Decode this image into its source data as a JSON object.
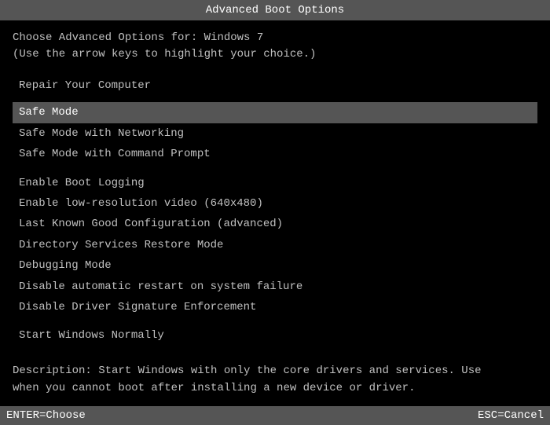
{
  "titleBar": {
    "title": "Advanced Boot Options"
  },
  "header": {
    "line1": "Choose Advanced Options for: Windows 7",
    "line2": "(Use the arrow keys to highlight your choice.)"
  },
  "menuItems": [
    {
      "id": "repair",
      "label": "Repair Your Computer",
      "selected": false,
      "topSection": true
    },
    {
      "id": "safe-mode",
      "label": "Safe Mode",
      "selected": true,
      "topSection": false
    },
    {
      "id": "safe-mode-networking",
      "label": "Safe Mode with Networking",
      "selected": false,
      "topSection": false
    },
    {
      "id": "safe-mode-cmd",
      "label": "Safe Mode with Command Prompt",
      "selected": false,
      "topSection": false
    },
    {
      "id": "enable-boot-logging",
      "label": "Enable Boot Logging",
      "selected": false,
      "topSection": false
    },
    {
      "id": "low-res-video",
      "label": "Enable low-resolution video (640x480)",
      "selected": false,
      "topSection": false
    },
    {
      "id": "last-known-good",
      "label": "Last Known Good Configuration (advanced)",
      "selected": false,
      "topSection": false
    },
    {
      "id": "directory-services",
      "label": "Directory Services Restore Mode",
      "selected": false,
      "topSection": false
    },
    {
      "id": "debugging-mode",
      "label": "Debugging Mode",
      "selected": false,
      "topSection": false
    },
    {
      "id": "disable-restart",
      "label": "Disable automatic restart on system failure",
      "selected": false,
      "topSection": false
    },
    {
      "id": "disable-driver-sig",
      "label": "Disable Driver Signature Enforcement",
      "selected": false,
      "topSection": false
    },
    {
      "id": "start-normally",
      "label": "Start Windows Normally",
      "selected": false,
      "topSection": false
    }
  ],
  "description": {
    "line1": "Description: Start Windows with only the core drivers and services. Use",
    "line2": "             when you cannot boot after installing a new device or driver."
  },
  "statusBar": {
    "enterLabel": "ENTER=Choose",
    "escLabel": "ESC=Cancel"
  }
}
